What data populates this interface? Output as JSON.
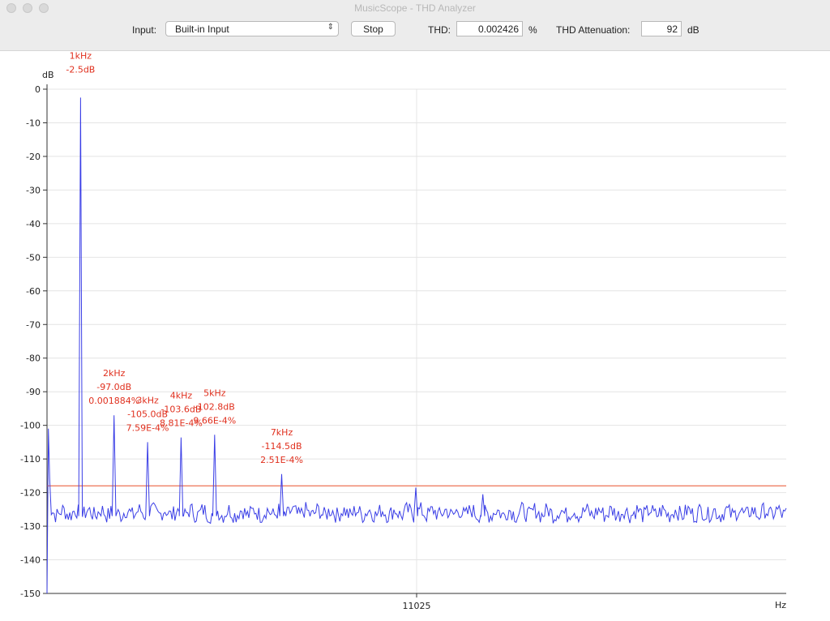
{
  "window": {
    "title": "MusicScope - THD Analyzer"
  },
  "toolbar": {
    "input_label": "Input:",
    "input_value": "Built-in Input",
    "stop_label": "Stop",
    "thd_label": "THD:",
    "thd_value": "0.002426",
    "thd_unit": "%",
    "attenuation_label": "THD Attenuation:",
    "attenuation_value": "92",
    "attenuation_unit": "dB"
  },
  "colors": {
    "trace": "#3a3ee6",
    "threshold": "#e8502a",
    "annotation": "#e0301e",
    "grid": "#e4e4e4"
  },
  "chart_data": {
    "type": "line",
    "ylabel": "dB",
    "xlabel": "Hz",
    "ylim": [
      -150,
      0
    ],
    "xlim": [
      0,
      22050
    ],
    "yticks": [
      0,
      -10,
      -20,
      -30,
      -40,
      -50,
      -60,
      -70,
      -80,
      -90,
      -100,
      -110,
      -120,
      -130,
      -140,
      -150
    ],
    "xticks": [
      11025
    ],
    "grid": true,
    "threshold_db": -118,
    "noise_floor_db": -126,
    "series": [
      {
        "peaks": [
          {
            "hz": 1000,
            "db": -2.5
          },
          {
            "hz": 2000,
            "db": -97.0
          },
          {
            "hz": 3000,
            "db": -105.0
          },
          {
            "hz": 4000,
            "db": -103.6
          },
          {
            "hz": 5000,
            "db": -102.8
          },
          {
            "hz": 7000,
            "db": -114.5
          },
          {
            "hz": 11000,
            "db": -118.5
          },
          {
            "hz": 13000,
            "db": -120.5
          }
        ]
      }
    ],
    "annotations": [
      {
        "hz": 1000,
        "freq": "1kHz",
        "level": "-2.5dB",
        "percent": ""
      },
      {
        "hz": 2000,
        "freq": "2kHz",
        "level": "-97.0dB",
        "percent": "0.001884%"
      },
      {
        "hz": 3000,
        "freq": "3kHz",
        "level": "-105.0dB",
        "percent": "7.59E-4%"
      },
      {
        "hz": 4000,
        "freq": "4kHz",
        "level": "-103.6dB",
        "percent": "8.81E-4%"
      },
      {
        "hz": 5000,
        "freq": "5kHz",
        "level": "-102.8dB",
        "percent": "9.66E-4%"
      },
      {
        "hz": 7000,
        "freq": "7kHz",
        "level": "-114.5dB",
        "percent": "2.51E-4%"
      }
    ]
  }
}
